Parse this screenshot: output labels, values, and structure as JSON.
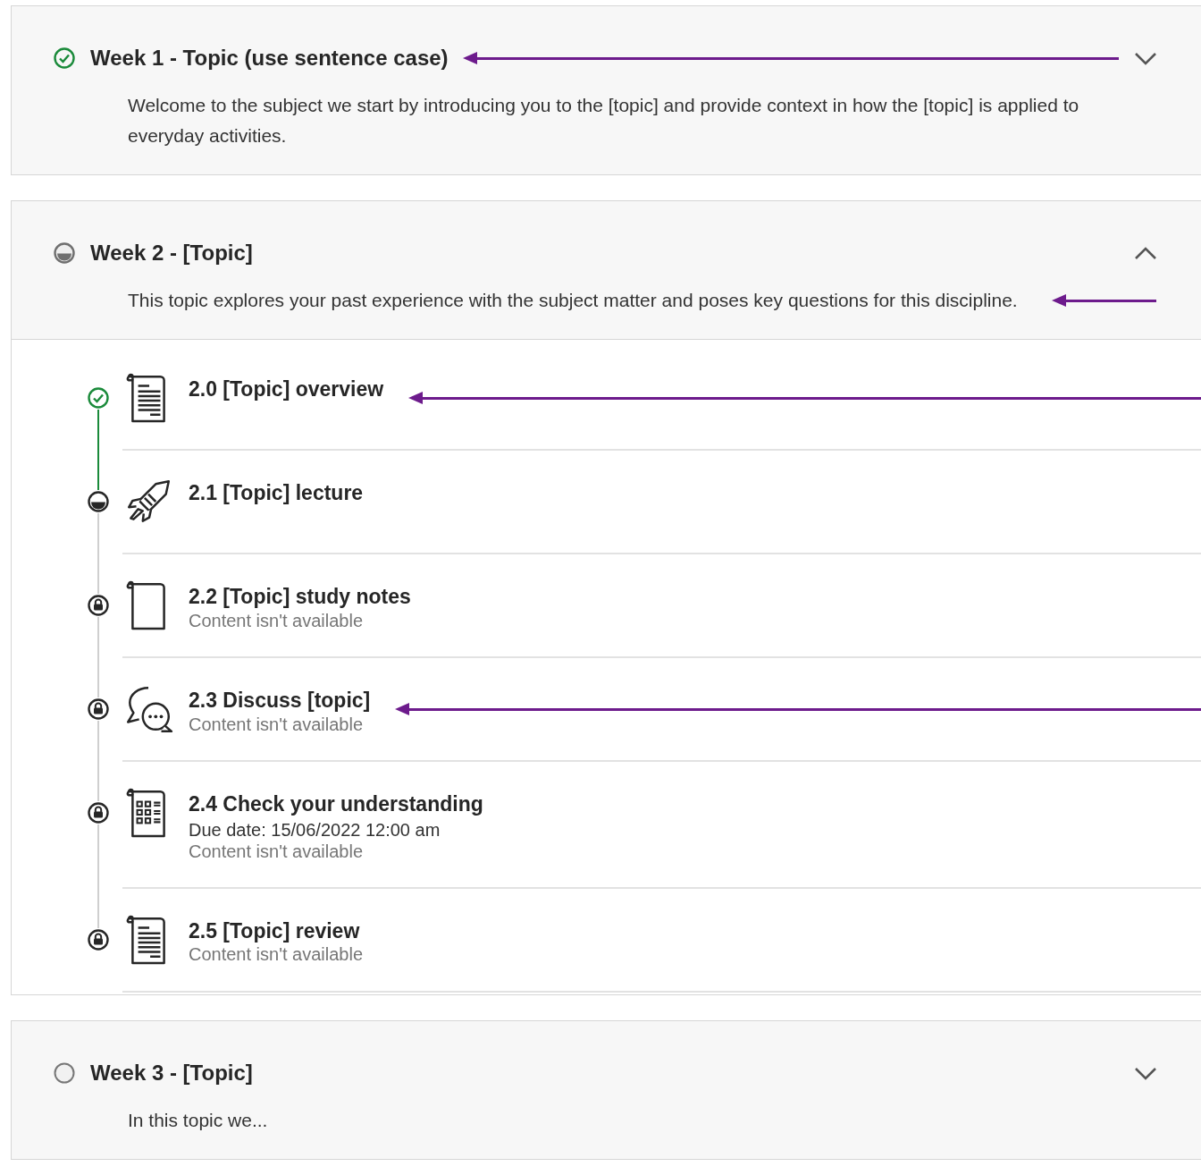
{
  "weeks": [
    {
      "complete": true,
      "started": true,
      "title": "Week 1 - Topic (use sentence case)",
      "title_arrow": true,
      "expanded": false,
      "description": "Welcome to the subject we start by introducing you to the [topic] and provide context in how the [topic] is applied to everyday activities.",
      "description_arrow": false
    },
    {
      "complete": false,
      "started": true,
      "title": "Week 2 - [Topic]",
      "title_arrow": false,
      "expanded": true,
      "description": "This topic explores your past experience with the subject matter and poses key questions for this discipline.",
      "description_arrow": true,
      "items": [
        {
          "complete": true,
          "started": true,
          "locked": false,
          "kind": "document",
          "title": "2.0 [Topic] overview",
          "arrow": true
        },
        {
          "complete": false,
          "started": true,
          "locked": false,
          "kind": "rocket",
          "title": "2.1 [Topic] lecture",
          "arrow": false
        },
        {
          "complete": false,
          "started": false,
          "locked": true,
          "kind": "page",
          "title": "2.2 [Topic] study notes",
          "note": "Content isn't available",
          "arrow": false
        },
        {
          "complete": false,
          "started": false,
          "locked": true,
          "kind": "discussion",
          "title": "2.3 Discuss [topic]",
          "note": "Content isn't available",
          "arrow": true
        },
        {
          "complete": false,
          "started": false,
          "locked": true,
          "kind": "test",
          "title": "2.4 Check your understanding",
          "due": "Due date: 15/06/2022 12:00 am",
          "note": "Content isn't available",
          "arrow": false
        },
        {
          "complete": false,
          "started": false,
          "locked": true,
          "kind": "document",
          "title": "2.5 [Topic] review",
          "note": "Content isn't available",
          "arrow": false
        }
      ]
    },
    {
      "complete": false,
      "started": false,
      "title": "Week 3 - [Topic]",
      "title_arrow": false,
      "expanded": false,
      "description": "In this topic we...",
      "description_arrow": false
    }
  ]
}
